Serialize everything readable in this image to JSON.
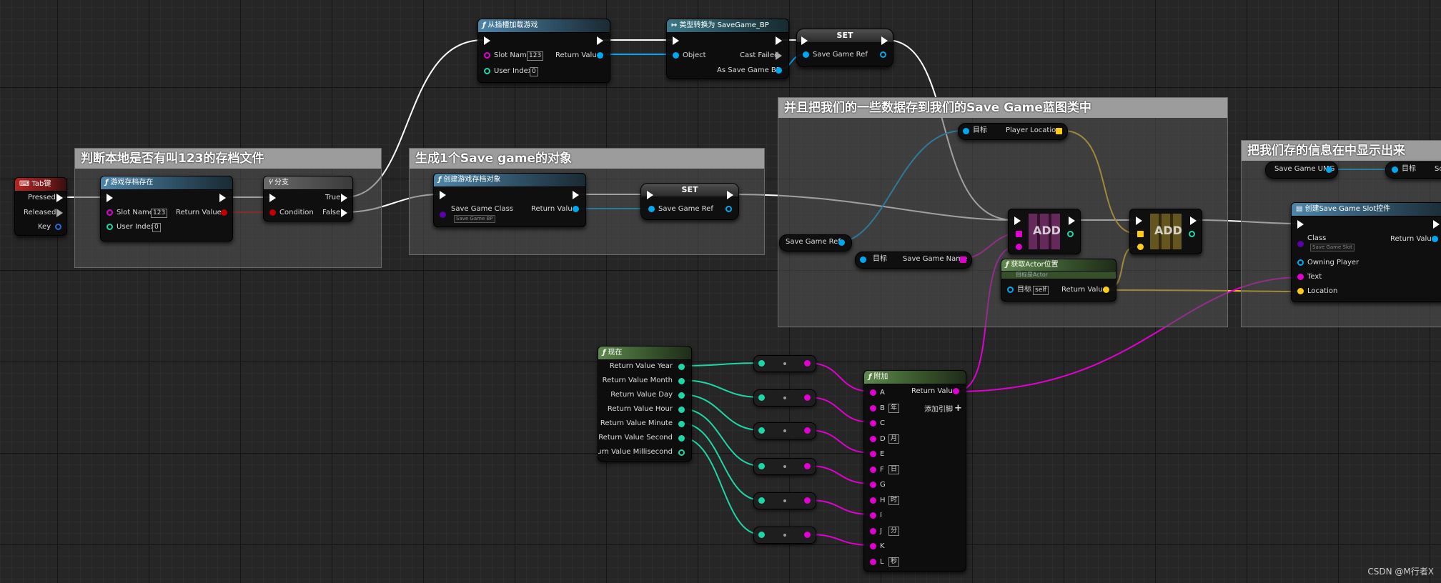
{
  "colors": {
    "exec": "#ffffff",
    "string": "#e000d0",
    "int": "#1fd6a6",
    "bool": "#c00000",
    "object": "#00a8f2",
    "vector": "#ffcb1b",
    "struct": "#1060b0"
  },
  "comments": {
    "c1": "判断本地是否有叫123的存档文件",
    "c2": "生成1个Save game的对象",
    "c3": "并且把我们的一些数据存到我们的Save Game蓝图类中",
    "c4": "把我们存的信息在中显示出来"
  },
  "nodes": {
    "tab_key": {
      "title": "Tab键",
      "pressed": "Pressed",
      "released": "Released",
      "key": "Key"
    },
    "does_save_exist": {
      "title": "游戏存档存在",
      "slot_name": "Slot Name",
      "slot_value": "123",
      "user_index": "User Index",
      "user_value": "0",
      "return_value": "Return Value"
    },
    "branch": {
      "title": "分支",
      "condition": "Condition",
      "true": "True",
      "false": "False"
    },
    "load_game": {
      "title": "从插槽加载游戏",
      "slot_name": "Slot Name",
      "slot_value": "123",
      "user_index": "User Index",
      "user_value": "0",
      "return_value": "Return Value"
    },
    "cast": {
      "title": "类型转换为 SaveGame_BP",
      "object": "Object",
      "cast_failed": "Cast Failed",
      "as_bp": "As Save Game BP"
    },
    "set1": {
      "title": "SET",
      "var": "Save Game Ref"
    },
    "create_save": {
      "title": "创建游戏存档对象",
      "class": "Save Game Class",
      "class_value": "Save Game BP",
      "return_value": "Return Value"
    },
    "set2": {
      "title": "SET",
      "var": "Save Game Ref"
    },
    "get_player_location": {
      "target": "目标",
      "var": "Player Location"
    },
    "save_game_ref": {
      "var": "Save Game Ref"
    },
    "get_save_game_name": {
      "target": "目标",
      "var": "Save Game Name"
    },
    "add1": {
      "label": "ADD"
    },
    "add2": {
      "label": "ADD"
    },
    "get_actor_location": {
      "title": "获取Actor位置",
      "subtitle": "目标是Actor",
      "target": "目标",
      "self": "self",
      "return_value": "Return Value"
    },
    "save_game_umg": {
      "var": "Save Game UMG"
    },
    "target_sc": {
      "target": "目标",
      "tail": "Sc"
    },
    "create_widget": {
      "title": "创建Save Game Slot控件",
      "class": "Class",
      "class_value": "Save Game Slot",
      "return_value": "Return Value",
      "owning_player": "Owning Player",
      "text": "Text",
      "location": "Location"
    },
    "now": {
      "title": "现在",
      "outputs": [
        "Return Value Year",
        "Return Value Month",
        "Return Value Day",
        "Return Value Hour",
        "Return Value Minute",
        "Return Value Second",
        "Return Value Millisecond"
      ]
    },
    "append": {
      "title": "附加",
      "return_value": "Return Value",
      "add_pin": "添加引脚",
      "pins": [
        {
          "name": "A",
          "value": ""
        },
        {
          "name": "B",
          "value": "年"
        },
        {
          "name": "C",
          "value": ""
        },
        {
          "name": "D",
          "value": "月"
        },
        {
          "name": "E",
          "value": ""
        },
        {
          "name": "F",
          "value": "日"
        },
        {
          "name": "G",
          "value": ""
        },
        {
          "name": "H",
          "value": "时"
        },
        {
          "name": "I",
          "value": ""
        },
        {
          "name": "J",
          "value": "分"
        },
        {
          "name": "K",
          "value": ""
        },
        {
          "name": "L",
          "value": "秒"
        }
      ]
    }
  },
  "watermark": "CSDN @M行者X"
}
